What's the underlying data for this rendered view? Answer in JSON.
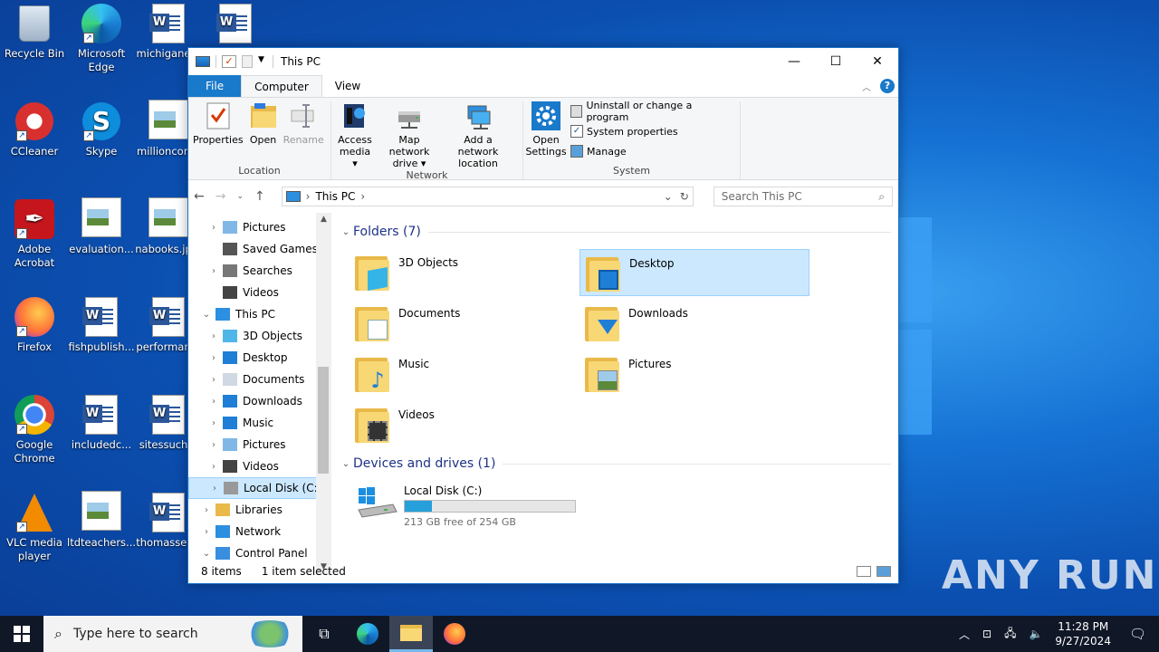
{
  "desktop": {
    "icons": [
      {
        "label": "Recycle Bin"
      },
      {
        "label": "Microsoft Edge"
      },
      {
        "label": "michigane..."
      },
      {
        "label": ""
      },
      {
        "label": "CCleaner"
      },
      {
        "label": "Skype"
      },
      {
        "label": "millioncon..."
      },
      {
        "label": "Adobe Acrobat"
      },
      {
        "label": "evaluation..."
      },
      {
        "label": "nabooks.jp..."
      },
      {
        "label": "Firefox"
      },
      {
        "label": "fishpublish..."
      },
      {
        "label": "performan..."
      },
      {
        "label": "Google Chrome"
      },
      {
        "label": "includedc..."
      },
      {
        "label": "sitessuch..."
      },
      {
        "label": "VLC media player"
      },
      {
        "label": "ltdteachers..."
      },
      {
        "label": "thomasset..."
      }
    ]
  },
  "window": {
    "title": "This PC",
    "tabs": [
      "File",
      "Computer",
      "View"
    ],
    "ribbon": {
      "location": {
        "name": "Location",
        "buttons": [
          "Properties",
          "Open",
          "Rename"
        ]
      },
      "network": {
        "name": "Network",
        "buttons": [
          "Access media ▾",
          "Map network drive ▾",
          "Add a network location"
        ]
      },
      "system": {
        "name": "System",
        "open_settings": "Open Settings",
        "links": [
          "Uninstall or change a program",
          "System properties",
          "Manage"
        ]
      }
    },
    "address": {
      "path": "This PC",
      "search_placeholder": "Search This PC"
    },
    "tree": [
      {
        "label": "Pictures",
        "indent": 1,
        "chev": ">"
      },
      {
        "label": "Saved Games",
        "indent": 1,
        "chev": ""
      },
      {
        "label": "Searches",
        "indent": 1,
        "chev": ">"
      },
      {
        "label": "Videos",
        "indent": 1,
        "chev": ""
      },
      {
        "label": "This PC",
        "indent": 0,
        "chev": "v"
      },
      {
        "label": "3D Objects",
        "indent": 1,
        "chev": ">"
      },
      {
        "label": "Desktop",
        "indent": 1,
        "chev": ">"
      },
      {
        "label": "Documents",
        "indent": 1,
        "chev": ">"
      },
      {
        "label": "Downloads",
        "indent": 1,
        "chev": ">"
      },
      {
        "label": "Music",
        "indent": 1,
        "chev": ">"
      },
      {
        "label": "Pictures",
        "indent": 1,
        "chev": ">"
      },
      {
        "label": "Videos",
        "indent": 1,
        "chev": ">"
      },
      {
        "label": "Local Disk (C:)",
        "indent": 1,
        "chev": ">",
        "selected": true
      },
      {
        "label": "Libraries",
        "indent": 0,
        "chev": ">"
      },
      {
        "label": "Network",
        "indent": 0,
        "chev": ">"
      },
      {
        "label": "Control Panel",
        "indent": 0,
        "chev": "v"
      }
    ],
    "folders_header": "Folders (7)",
    "folders": [
      {
        "label": "3D Objects"
      },
      {
        "label": "Desktop",
        "selected": true
      },
      {
        "label": "Documents"
      },
      {
        "label": "Downloads"
      },
      {
        "label": "Music"
      },
      {
        "label": "Pictures"
      },
      {
        "label": "Videos"
      }
    ],
    "devices_header": "Devices and drives (1)",
    "drive": {
      "label": "Local Disk (C:)",
      "free": "213 GB free of 254 GB",
      "used_fraction": 0.16
    },
    "status": {
      "items": "8 items",
      "selected": "1 item selected"
    }
  },
  "taskbar": {
    "search_placeholder": "Type here to search",
    "time": "11:28 PM",
    "date": "9/27/2024"
  },
  "watermark": "ANY RUN"
}
